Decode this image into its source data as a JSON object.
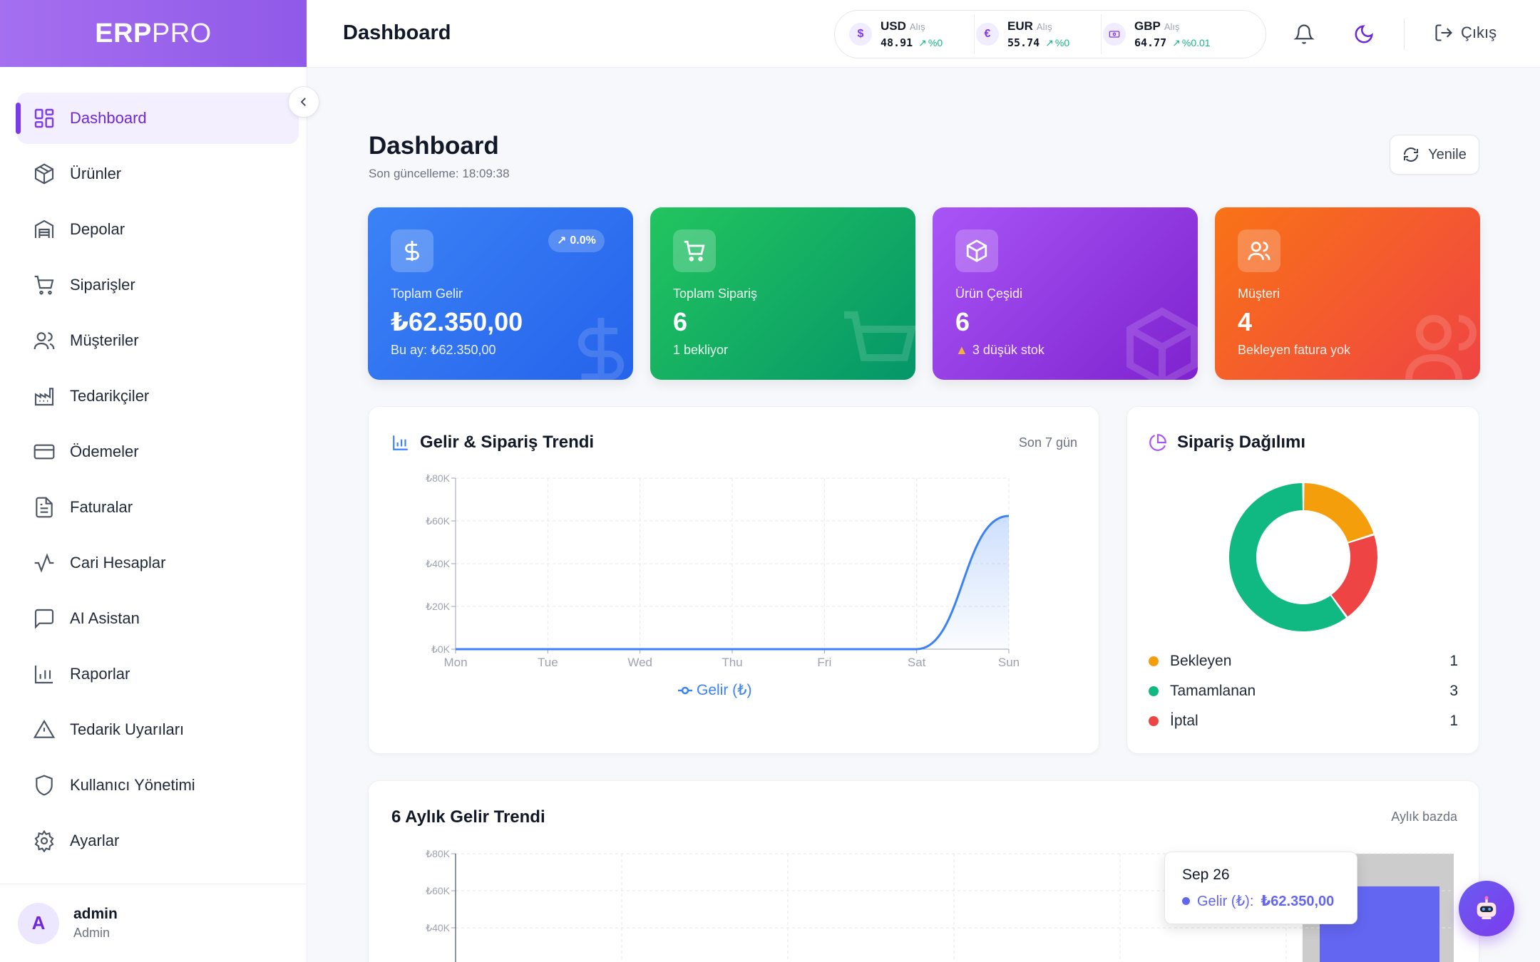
{
  "sidebar": {
    "logo_bold": "ERP",
    "logo_light": "PRO",
    "items": [
      {
        "label": "Dashboard",
        "icon": "grid-icon"
      },
      {
        "label": "Ürünler",
        "icon": "box-icon"
      },
      {
        "label": "Depolar",
        "icon": "warehouse-icon"
      },
      {
        "label": "Siparişler",
        "icon": "cart-icon"
      },
      {
        "label": "Müşteriler",
        "icon": "users-icon"
      },
      {
        "label": "Tedarikçiler",
        "icon": "factory-icon"
      },
      {
        "label": "Ödemeler",
        "icon": "credit-card-icon"
      },
      {
        "label": "Faturalar",
        "icon": "file-text-icon"
      },
      {
        "label": "Cari Hesaplar",
        "icon": "activity-icon"
      },
      {
        "label": "AI Asistan",
        "icon": "message-square-icon"
      },
      {
        "label": "Raporlar",
        "icon": "bar-chart-icon"
      },
      {
        "label": "Tedarik Uyarıları",
        "icon": "alert-triangle-icon"
      },
      {
        "label": "Kullanıcı Yönetimi",
        "icon": "shield-icon"
      },
      {
        "label": "Ayarlar",
        "icon": "gear-icon"
      }
    ],
    "user": {
      "initial": "A",
      "name": "admin",
      "role": "Admin"
    }
  },
  "header": {
    "title": "Dashboard",
    "currencies": [
      {
        "code": "USD",
        "type": "Alış",
        "symbol": "$",
        "value": "48.91",
        "change": "%0"
      },
      {
        "code": "EUR",
        "type": "Alış",
        "symbol": "€",
        "value": "55.74",
        "change": "%0"
      },
      {
        "code": "GBP",
        "type": "Alış",
        "symbol": "£",
        "value": "64.77",
        "change": "%0.01"
      }
    ],
    "logout_label": "Çıkış"
  },
  "main": {
    "title": "Dashboard",
    "last_update": "Son güncelleme: 18:09:38",
    "refresh_label": "Yenile",
    "stats": [
      {
        "label": "Toplam Gelir",
        "value": "₺62.350,00",
        "sub": "Bu ay: ₺62.350,00",
        "badge": "0.0%",
        "color_from": "#3b82f6",
        "color_to": "#2563eb"
      },
      {
        "label": "Toplam Sipariş",
        "value": "6",
        "sub": "1 bekliyor",
        "color_from": "#22c55e",
        "color_to": "#059669"
      },
      {
        "label": "Ürün Çeşidi",
        "value": "6",
        "sub": "3 düşük stok",
        "color_from": "#a855f7",
        "color_to": "#7e22ce"
      },
      {
        "label": "Müşteri",
        "value": "4",
        "sub": "Bekleyen fatura yok",
        "color_from": "#f97316",
        "color_to": "#ef4444"
      }
    ]
  },
  "trend": {
    "title": "Gelir & Sipariş Trendi",
    "note": "Son 7 gün",
    "legend": "Gelir (₺)"
  },
  "distribution": {
    "title": "Sipariş Dağılımı",
    "items": [
      {
        "label": "Bekleyen",
        "value": 1,
        "color": "#f59e0b"
      },
      {
        "label": "Tamamlanan",
        "value": 3,
        "color": "#10b981"
      },
      {
        "label": "İptal",
        "value": 1,
        "color": "#ef4444"
      }
    ]
  },
  "monthly": {
    "title": "6 Aylık Gelir Trendi",
    "note": "Aylık bazda",
    "tooltip": {
      "date": "Sep 26",
      "series": "Gelir (₺):",
      "value": "₺62.350,00"
    }
  },
  "chart_data": [
    {
      "type": "area",
      "title": "Gelir & Sipariş Trendi",
      "categories": [
        "Mon",
        "Tue",
        "Wed",
        "Thu",
        "Fri",
        "Sat",
        "Sun"
      ],
      "series": [
        {
          "name": "Gelir (₺)",
          "values": [
            0,
            0,
            0,
            0,
            0,
            0,
            62350
          ]
        }
      ],
      "y_ticks": [
        "₺0K",
        "₺20K",
        "₺40K",
        "₺60K",
        "₺80K"
      ],
      "ylim": [
        0,
        80000
      ],
      "grid": true,
      "legend": "bottom"
    },
    {
      "type": "pie",
      "title": "Sipariş Dağılımı",
      "categories": [
        "Bekleyen",
        "Tamamlanan",
        "İptal"
      ],
      "values": [
        1,
        3,
        1
      ]
    },
    {
      "type": "bar",
      "title": "6 Aylık Gelir Trendi",
      "categories": [
        "Sep 26"
      ],
      "values": [
        62350
      ],
      "y_ticks": [
        "₺40K",
        "₺60K",
        "₺80K"
      ],
      "ylim": [
        0,
        80000
      ],
      "grid": true
    }
  ],
  "colors": {
    "accent": "#7c3aed",
    "line": "#3b82f6",
    "bar": "#6366f1"
  }
}
